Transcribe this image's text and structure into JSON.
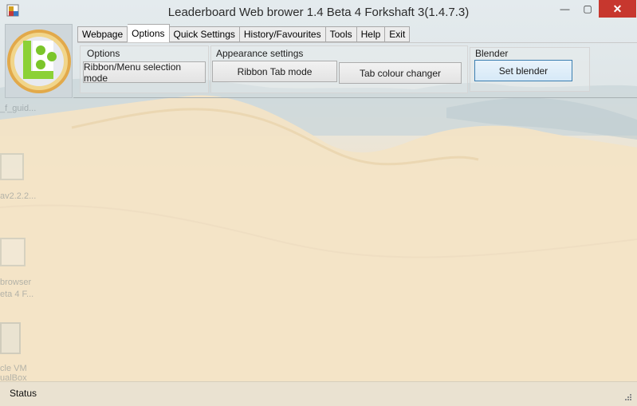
{
  "window": {
    "title": "Leaderboard Web brower 1.4 Beta 4 Forkshaft 3(1.4.7.3)",
    "minimize_glyph": "—",
    "maximize_glyph": "▢",
    "close_glyph": "✕"
  },
  "tabs": [
    {
      "label": "Webpage",
      "active": false
    },
    {
      "label": "Options",
      "active": true
    },
    {
      "label": "Quick Settings",
      "active": false
    },
    {
      "label": "History/Favourites",
      "active": false
    },
    {
      "label": "Tools",
      "active": false
    },
    {
      "label": "Help",
      "active": false
    },
    {
      "label": "Exit",
      "active": false
    }
  ],
  "groups": {
    "options": {
      "label": "Options",
      "buttons": [
        "Ribbon/Menu selection mode"
      ]
    },
    "appearance": {
      "label": "Appearance settings",
      "buttons": [
        "Ribbon Tab mode",
        "Tab colour changer"
      ]
    },
    "blender": {
      "label": "Blender",
      "buttons": [
        "Set blender"
      ]
    }
  },
  "status": {
    "label": "Status"
  },
  "desktop_fragments": [
    "_f_guid...",
    "av2.2.2...",
    "browser",
    "eta 4 F...",
    "cle VM",
    "ualBox"
  ],
  "colors": {
    "close_button": "#c7372e",
    "focused_button_border": "#3c7fb1"
  }
}
